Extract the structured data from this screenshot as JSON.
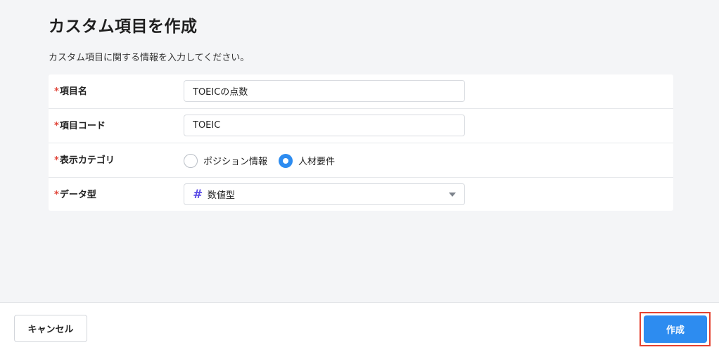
{
  "page": {
    "title": "カスタム項目を作成",
    "description": "カスタム項目に関する情報を入力してください。"
  },
  "form": {
    "required_mark": "*",
    "item_name": {
      "label": "項目名",
      "value": "TOEICの点数"
    },
    "item_code": {
      "label": "項目コード",
      "value": "TOEIC"
    },
    "display_category": {
      "label": "表示カテゴリ",
      "options": [
        {
          "label": "ポジション情報",
          "checked": false
        },
        {
          "label": "人材要件",
          "checked": true
        }
      ]
    },
    "data_type": {
      "label": "データ型",
      "icon": "hash-icon",
      "value": "数値型"
    }
  },
  "footer": {
    "cancel_label": "キャンセル",
    "create_label": "作成"
  },
  "colors": {
    "primary": "#2d8cf0",
    "required": "#e0463a",
    "icon_accent": "#5b4ce6",
    "highlight": "#e5412f"
  }
}
